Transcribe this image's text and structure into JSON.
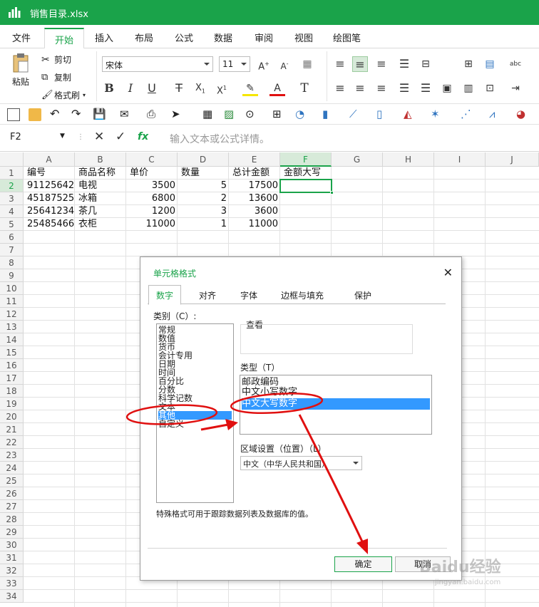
{
  "titlebar": {
    "filename": "销售目录.xlsx",
    "accent": "#1aa34a"
  },
  "menu": [
    "文件",
    "开始",
    "插入",
    "布局",
    "公式",
    "数据",
    "审阅",
    "视图",
    "绘图笔"
  ],
  "ribbon": {
    "paste": "粘贴",
    "cut": "剪切",
    "copy": "复制",
    "format_painter": "格式刷",
    "font_name": "宋体",
    "font_size": "11"
  },
  "formula_bar": {
    "cell_ref": "F2",
    "fx": "fx",
    "placeholder": "输入文本或公式详情。"
  },
  "sheet": {
    "columns": [
      "A",
      "B",
      "C",
      "D",
      "E",
      "F",
      "G",
      "H",
      "I",
      "J"
    ],
    "rows": [
      "1",
      "2",
      "3",
      "4",
      "5",
      "6",
      "7",
      "8",
      "9",
      "10",
      "11",
      "12",
      "13",
      "14",
      "15",
      "16",
      "17",
      "18",
      "19",
      "20",
      "21",
      "22",
      "23",
      "24",
      "25",
      "26",
      "27",
      "28",
      "29",
      "30",
      "31",
      "32",
      "33",
      "34"
    ],
    "header_row": [
      "编号",
      "商品名称",
      "单价",
      "数量",
      "总计金额",
      "金额大写"
    ],
    "data": [
      [
        "91125642",
        "电视",
        "3500",
        "5",
        "17500"
      ],
      [
        "45187525",
        "冰箱",
        "6800",
        "2",
        "13600"
      ],
      [
        "25641234",
        "茶几",
        "1200",
        "3",
        "3600"
      ],
      [
        "25485466",
        "衣柜",
        "11000",
        "1",
        "11000"
      ]
    ]
  },
  "dialog": {
    "title": "单元格格式",
    "tabs": [
      "数字",
      "对齐",
      "字体",
      "边框与填充",
      "保护"
    ],
    "category_label": "类别（C）:",
    "categories": [
      "常规",
      "数值",
      "货币",
      "会计专用",
      "日期",
      "时间",
      "百分比",
      "分数",
      "科学记数",
      "文本",
      "其他",
      "自定义"
    ],
    "selected_category": "其他",
    "preview_label": "查看",
    "type_label": "类型（T）",
    "types": [
      "邮政编码",
      "中文小写数字",
      "中文大写数字"
    ],
    "selected_type": "中文大写数字",
    "locale_label": "区域设置（位置）（L）",
    "locale_value": "中文（中华人民共和国）",
    "description": "特殊格式可用于跟踪数据列表及数据库的值。",
    "ok": "确定",
    "cancel": "取消"
  },
  "watermark": {
    "line1": "Baidu经验",
    "line2": "jingyan.baidu.com"
  }
}
